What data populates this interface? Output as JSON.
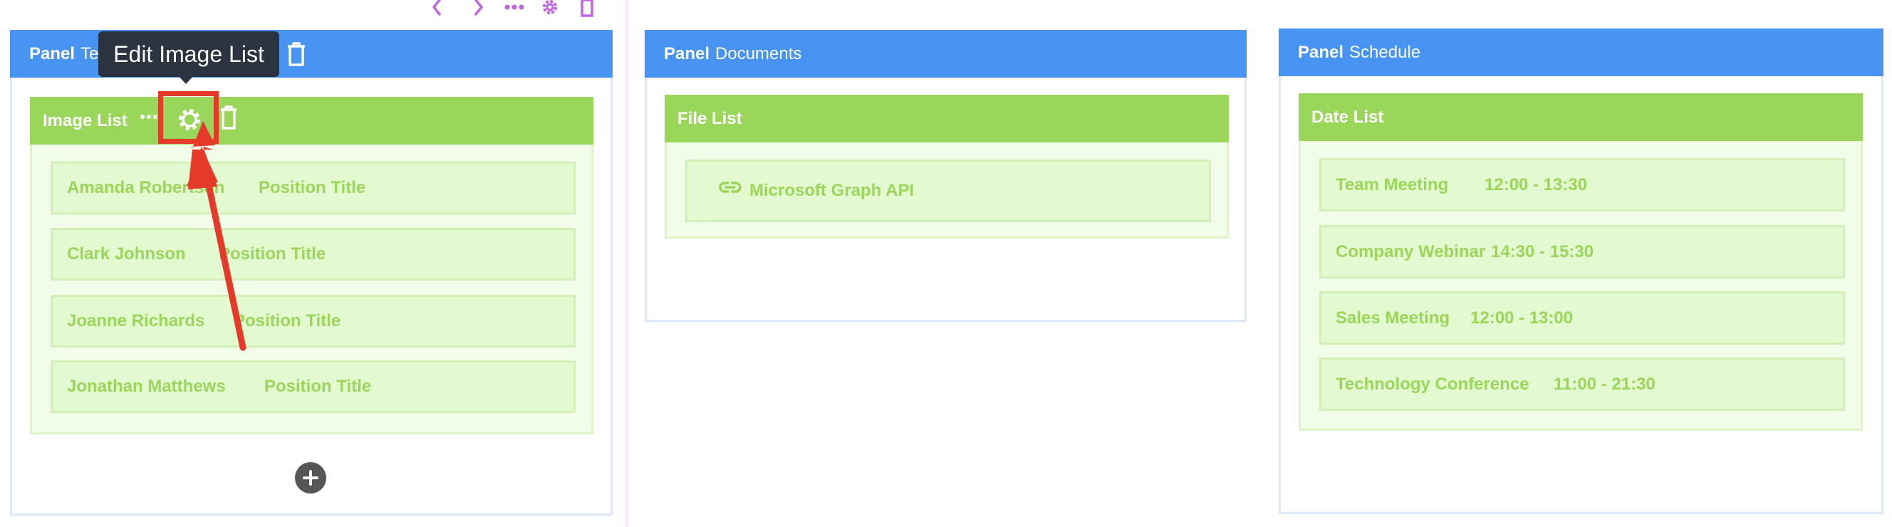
{
  "toolbar": {
    "icons": [
      "chevron-left-icon",
      "chevron-right-icon",
      "more-dots-icon",
      "gear-icon",
      "trash-icon"
    ],
    "color": "#c064e0"
  },
  "panels": [
    {
      "label": "Panel",
      "title": "Team"
    },
    {
      "label": "Panel",
      "title": "Documents"
    },
    {
      "label": "Panel",
      "title": "Schedule"
    }
  ],
  "tooltip": {
    "text": "Edit Image List"
  },
  "image_list": {
    "title": "Image List",
    "items": [
      {
        "name": "Amanda Robertson",
        "position": "Position Title"
      },
      {
        "name": "Clark Johnson",
        "position": "Position Title"
      },
      {
        "name": "Joanne Richards",
        "position": "Position Title"
      },
      {
        "name": "Jonathan Matthews",
        "position": "Position Title"
      }
    ]
  },
  "file_list": {
    "title": "File List",
    "items": [
      {
        "label": "Microsoft Graph API",
        "icon": "link-icon"
      }
    ]
  },
  "date_list": {
    "title": "Date List",
    "items": [
      {
        "event": "Team Meeting",
        "time": "12:00 - 13:30"
      },
      {
        "event": "Company Webinar",
        "time": "14:30 - 15:30"
      },
      {
        "event": "Sales Meeting",
        "time": "12:00 - 13:00"
      },
      {
        "event": "Technology Conference",
        "time": "11:00 - 21:30"
      }
    ]
  },
  "colors": {
    "panel_header": "#4693f2",
    "list_header": "#9ad65a",
    "annotation_red": "#e53a2a",
    "tooltip_bg": "#2c3340"
  }
}
